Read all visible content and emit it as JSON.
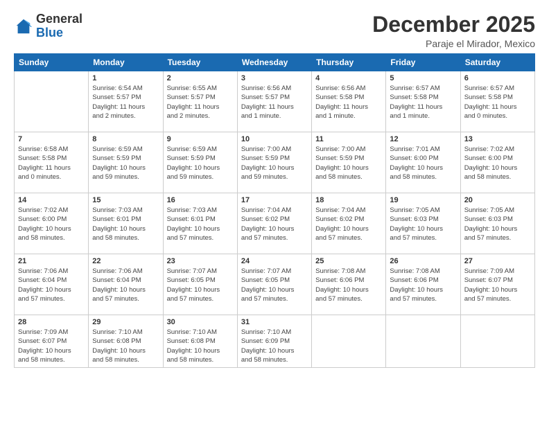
{
  "logo": {
    "general": "General",
    "blue": "Blue"
  },
  "header": {
    "month": "December 2025",
    "location": "Paraje el Mirador, Mexico"
  },
  "weekdays": [
    "Sunday",
    "Monday",
    "Tuesday",
    "Wednesday",
    "Thursday",
    "Friday",
    "Saturday"
  ],
  "weeks": [
    [
      {
        "day": "",
        "info": ""
      },
      {
        "day": "1",
        "info": "Sunrise: 6:54 AM\nSunset: 5:57 PM\nDaylight: 11 hours\nand 2 minutes."
      },
      {
        "day": "2",
        "info": "Sunrise: 6:55 AM\nSunset: 5:57 PM\nDaylight: 11 hours\nand 2 minutes."
      },
      {
        "day": "3",
        "info": "Sunrise: 6:56 AM\nSunset: 5:57 PM\nDaylight: 11 hours\nand 1 minute."
      },
      {
        "day": "4",
        "info": "Sunrise: 6:56 AM\nSunset: 5:58 PM\nDaylight: 11 hours\nand 1 minute."
      },
      {
        "day": "5",
        "info": "Sunrise: 6:57 AM\nSunset: 5:58 PM\nDaylight: 11 hours\nand 1 minute."
      },
      {
        "day": "6",
        "info": "Sunrise: 6:57 AM\nSunset: 5:58 PM\nDaylight: 11 hours\nand 0 minutes."
      }
    ],
    [
      {
        "day": "7",
        "info": "Sunrise: 6:58 AM\nSunset: 5:58 PM\nDaylight: 11 hours\nand 0 minutes."
      },
      {
        "day": "8",
        "info": "Sunrise: 6:59 AM\nSunset: 5:59 PM\nDaylight: 10 hours\nand 59 minutes."
      },
      {
        "day": "9",
        "info": "Sunrise: 6:59 AM\nSunset: 5:59 PM\nDaylight: 10 hours\nand 59 minutes."
      },
      {
        "day": "10",
        "info": "Sunrise: 7:00 AM\nSunset: 5:59 PM\nDaylight: 10 hours\nand 59 minutes."
      },
      {
        "day": "11",
        "info": "Sunrise: 7:00 AM\nSunset: 5:59 PM\nDaylight: 10 hours\nand 58 minutes."
      },
      {
        "day": "12",
        "info": "Sunrise: 7:01 AM\nSunset: 6:00 PM\nDaylight: 10 hours\nand 58 minutes."
      },
      {
        "day": "13",
        "info": "Sunrise: 7:02 AM\nSunset: 6:00 PM\nDaylight: 10 hours\nand 58 minutes."
      }
    ],
    [
      {
        "day": "14",
        "info": "Sunrise: 7:02 AM\nSunset: 6:00 PM\nDaylight: 10 hours\nand 58 minutes."
      },
      {
        "day": "15",
        "info": "Sunrise: 7:03 AM\nSunset: 6:01 PM\nDaylight: 10 hours\nand 58 minutes."
      },
      {
        "day": "16",
        "info": "Sunrise: 7:03 AM\nSunset: 6:01 PM\nDaylight: 10 hours\nand 57 minutes."
      },
      {
        "day": "17",
        "info": "Sunrise: 7:04 AM\nSunset: 6:02 PM\nDaylight: 10 hours\nand 57 minutes."
      },
      {
        "day": "18",
        "info": "Sunrise: 7:04 AM\nSunset: 6:02 PM\nDaylight: 10 hours\nand 57 minutes."
      },
      {
        "day": "19",
        "info": "Sunrise: 7:05 AM\nSunset: 6:03 PM\nDaylight: 10 hours\nand 57 minutes."
      },
      {
        "day": "20",
        "info": "Sunrise: 7:05 AM\nSunset: 6:03 PM\nDaylight: 10 hours\nand 57 minutes."
      }
    ],
    [
      {
        "day": "21",
        "info": "Sunrise: 7:06 AM\nSunset: 6:04 PM\nDaylight: 10 hours\nand 57 minutes."
      },
      {
        "day": "22",
        "info": "Sunrise: 7:06 AM\nSunset: 6:04 PM\nDaylight: 10 hours\nand 57 minutes."
      },
      {
        "day": "23",
        "info": "Sunrise: 7:07 AM\nSunset: 6:05 PM\nDaylight: 10 hours\nand 57 minutes."
      },
      {
        "day": "24",
        "info": "Sunrise: 7:07 AM\nSunset: 6:05 PM\nDaylight: 10 hours\nand 57 minutes."
      },
      {
        "day": "25",
        "info": "Sunrise: 7:08 AM\nSunset: 6:06 PM\nDaylight: 10 hours\nand 57 minutes."
      },
      {
        "day": "26",
        "info": "Sunrise: 7:08 AM\nSunset: 6:06 PM\nDaylight: 10 hours\nand 57 minutes."
      },
      {
        "day": "27",
        "info": "Sunrise: 7:09 AM\nSunset: 6:07 PM\nDaylight: 10 hours\nand 57 minutes."
      }
    ],
    [
      {
        "day": "28",
        "info": "Sunrise: 7:09 AM\nSunset: 6:07 PM\nDaylight: 10 hours\nand 58 minutes."
      },
      {
        "day": "29",
        "info": "Sunrise: 7:10 AM\nSunset: 6:08 PM\nDaylight: 10 hours\nand 58 minutes."
      },
      {
        "day": "30",
        "info": "Sunrise: 7:10 AM\nSunset: 6:08 PM\nDaylight: 10 hours\nand 58 minutes."
      },
      {
        "day": "31",
        "info": "Sunrise: 7:10 AM\nSunset: 6:09 PM\nDaylight: 10 hours\nand 58 minutes."
      },
      {
        "day": "",
        "info": ""
      },
      {
        "day": "",
        "info": ""
      },
      {
        "day": "",
        "info": ""
      }
    ]
  ]
}
